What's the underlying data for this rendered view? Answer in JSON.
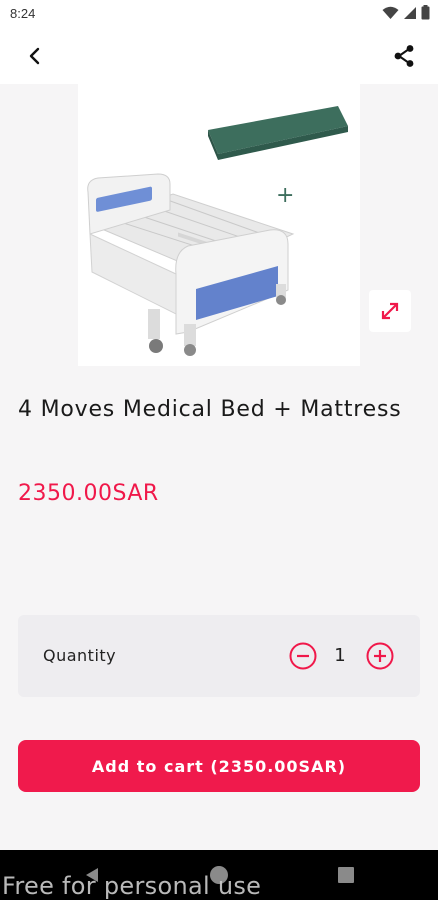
{
  "status_bar": {
    "time": "8:24",
    "icons": [
      "wifi-icon",
      "signal-icon",
      "battery-icon"
    ]
  },
  "top_bar": {
    "back_icon": "back-arrow-icon",
    "share_icon": "share-icon"
  },
  "product": {
    "title": "4 Moves Medical Bed + Mattress",
    "price": "2350.00SAR",
    "image_plus": "+"
  },
  "quantity": {
    "label": "Quantity",
    "value": "1"
  },
  "cart": {
    "button_label": "Add to cart (2350.00SAR)"
  },
  "watermark": "Free for personal use",
  "colors": {
    "accent": "#f01a4c",
    "background": "#f6f5f6",
    "qty_box": "#eeedf0"
  }
}
